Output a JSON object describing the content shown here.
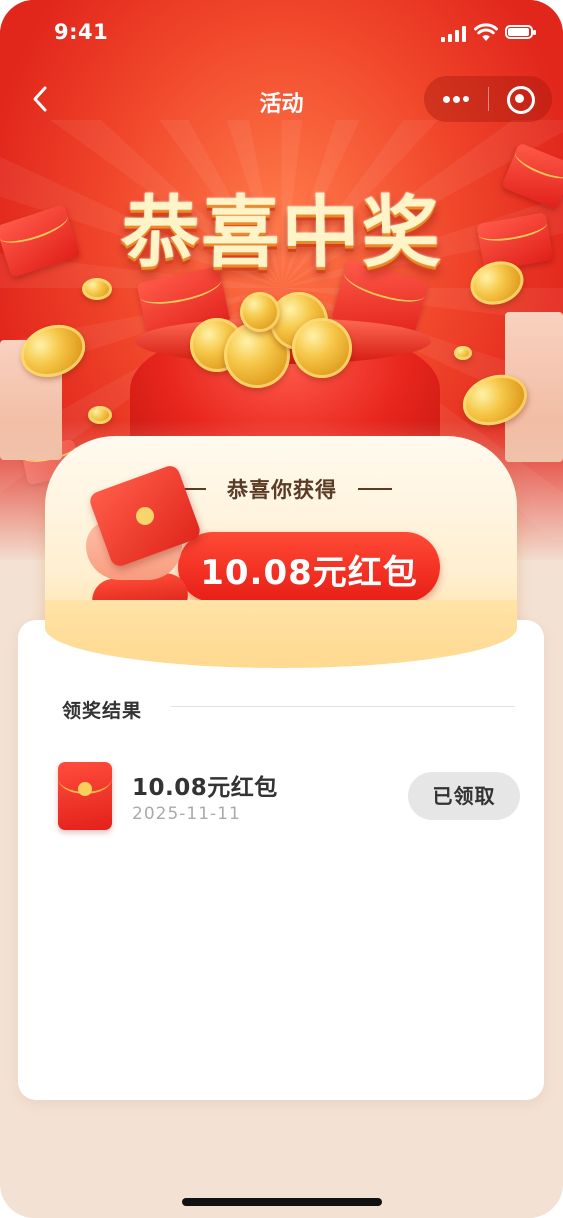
{
  "status_bar": {
    "time": "9:41"
  },
  "nav": {
    "title": "活动"
  },
  "hero": {
    "headline": "恭喜中奖"
  },
  "banner": {
    "title": "恭喜你获得",
    "amount": "10.08元红包"
  },
  "result": {
    "section_label": "领奖结果",
    "item": {
      "title": "10.08元红包",
      "date": "2025-11-11",
      "status_button": "已领取"
    }
  },
  "colors": {
    "primary_red": "#e81e16",
    "background": "#f3e2d3",
    "gold": "#f6c84a"
  },
  "icons": [
    "back-icon",
    "signal-icon",
    "wifi-icon",
    "battery-icon",
    "more-icon",
    "close-target-icon",
    "red-envelope-icon"
  ]
}
